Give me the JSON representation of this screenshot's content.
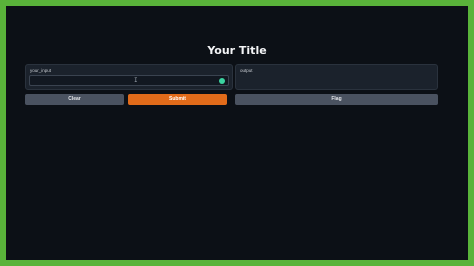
{
  "page": {
    "title": "Your Title"
  },
  "input_panel": {
    "label": "your_input",
    "value": ""
  },
  "output_panel": {
    "label": "output"
  },
  "buttons": {
    "clear": "Clear",
    "submit": "Submit",
    "flag": "Flag"
  },
  "colors": {
    "background": "#0c1016",
    "panel": "#1b222c",
    "accent": "#e16b1a",
    "status": "#3bd3a0",
    "frame": "#59b33a"
  },
  "icons": {
    "status_indicator": "status-dot-icon",
    "cursor": "text-cursor-icon"
  }
}
